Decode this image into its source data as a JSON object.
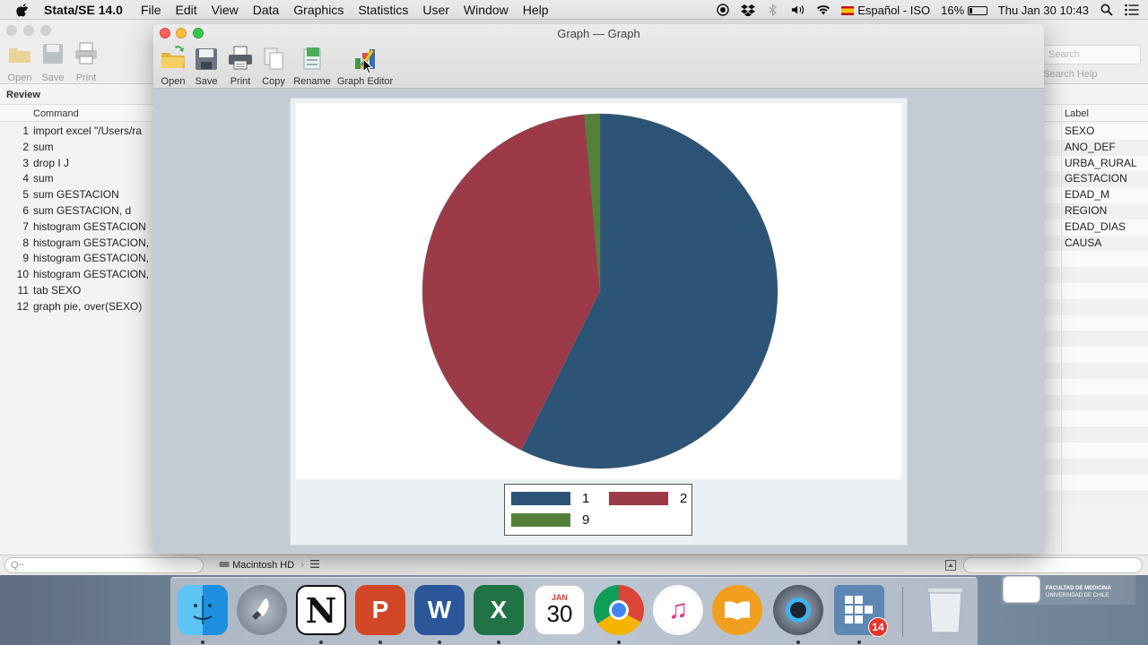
{
  "menubar": {
    "app_name": "Stata/SE 14.0",
    "items": [
      "File",
      "Edit",
      "View",
      "Data",
      "Graphics",
      "Statistics",
      "User",
      "Window",
      "Help"
    ],
    "input_source": "Español - ISO",
    "battery": "16%",
    "clock": "Thu Jan 30  10:43"
  },
  "main_toolbar": {
    "open": "Open",
    "save": "Save",
    "print": "Print"
  },
  "review": {
    "title": "Review",
    "column": "Command",
    "items": [
      {
        "num": "1",
        "cmd": "import excel \"/Users/ra"
      },
      {
        "num": "2",
        "cmd": "sum"
      },
      {
        "num": "3",
        "cmd": "drop I J"
      },
      {
        "num": "4",
        "cmd": "sum"
      },
      {
        "num": "5",
        "cmd": "sum GESTACION"
      },
      {
        "num": "6",
        "cmd": "sum GESTACION, d"
      },
      {
        "num": "7",
        "cmd": "histogram GESTACION"
      },
      {
        "num": "8",
        "cmd": "histogram GESTACION,"
      },
      {
        "num": "9",
        "cmd": "histogram GESTACION,"
      },
      {
        "num": "10",
        "cmd": "histogram GESTACION,"
      },
      {
        "num": "11",
        "cmd": "tab SEXO"
      },
      {
        "num": "12",
        "cmd": "graph pie, over(SEXO)"
      }
    ],
    "search_placeholder": "Q~"
  },
  "variables": {
    "search_placeholder": "Search",
    "help_label": "Search Help",
    "column": "Label",
    "items": [
      "SEXO",
      "ANO_DEF",
      "URBA_RURAL",
      "GESTACION",
      "EDAD_M",
      "REGION",
      "EDAD_DIAS",
      "CAUSA"
    ]
  },
  "statusbar": {
    "path": "Macintosh HD",
    "sep": "›"
  },
  "graph_window": {
    "title": "Graph — Graph",
    "toolbar": {
      "open": "Open",
      "save": "Save",
      "print": "Print",
      "copy": "Copy",
      "rename": "Rename",
      "editor": "Graph Editor"
    }
  },
  "chart_data": {
    "type": "pie",
    "categories": [
      "1",
      "2",
      "9"
    ],
    "values": [
      57.3,
      41.3,
      1.4
    ],
    "colors": [
      "#2c5476",
      "#9c3b47",
      "#53813a"
    ],
    "legend_position": "bottom",
    "start_angle_deg": 0,
    "direction": "clockwise"
  },
  "dock": {
    "apps": [
      {
        "name": "Finder",
        "icon": "finder-icon"
      },
      {
        "name": "Launchpad",
        "icon": "launchpad-icon"
      },
      {
        "name": "Notion",
        "icon": "notion-icon",
        "glyph": "N"
      },
      {
        "name": "PowerPoint",
        "icon": "powerpoint-icon",
        "glyph": "P"
      },
      {
        "name": "Word",
        "icon": "word-icon",
        "glyph": "W"
      },
      {
        "name": "Excel",
        "icon": "excel-icon",
        "glyph": "X"
      },
      {
        "name": "Calendar",
        "icon": "calendar-icon",
        "month": "JAN",
        "day": "30"
      },
      {
        "name": "Chrome",
        "icon": "chrome-icon"
      },
      {
        "name": "iTunes",
        "icon": "itunes-icon"
      },
      {
        "name": "iBooks",
        "icon": "ibooks-icon"
      },
      {
        "name": "QuickTime",
        "icon": "quicktime-icon"
      },
      {
        "name": "Stata",
        "icon": "stata-icon",
        "badge": "14"
      }
    ],
    "trash": "trash-icon"
  },
  "watermark": {
    "line1": "FACULTAD DE MEDICINA",
    "line2": "UNIVERSIDAD DE CHILE"
  }
}
